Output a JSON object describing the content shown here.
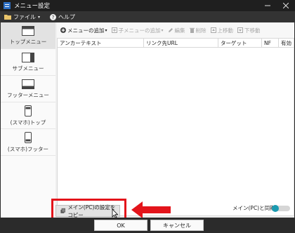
{
  "window": {
    "title": "メニュー設定"
  },
  "menubar": {
    "file": "ファイル",
    "help": "ヘルプ"
  },
  "sidebar": {
    "items": [
      {
        "label": "トップメニュー"
      },
      {
        "label": "サブメニュー"
      },
      {
        "label": "フッターメニュー"
      },
      {
        "label": "(スマホ)トップ"
      },
      {
        "label": "(スマホ)フッター"
      }
    ]
  },
  "toolbar": {
    "add": "メニューの追加",
    "add_child": "子メニューの追加",
    "edit": "編集",
    "delete": "削除",
    "move_up": "上移動",
    "move_down": "下移動"
  },
  "table": {
    "columns": [
      "アンカーテキスト",
      "リンク先URL",
      "ターゲット",
      "NF",
      "有効"
    ]
  },
  "bottom": {
    "copy_button": "メイン(PC)の設定をコピー",
    "sync_label": "メイン(PC)と同期"
  },
  "dialog": {
    "ok": "OK",
    "cancel": "キャンセル"
  },
  "colors": {
    "highlight": "#e3141b",
    "toggle_accent": "#1a9ab0"
  }
}
